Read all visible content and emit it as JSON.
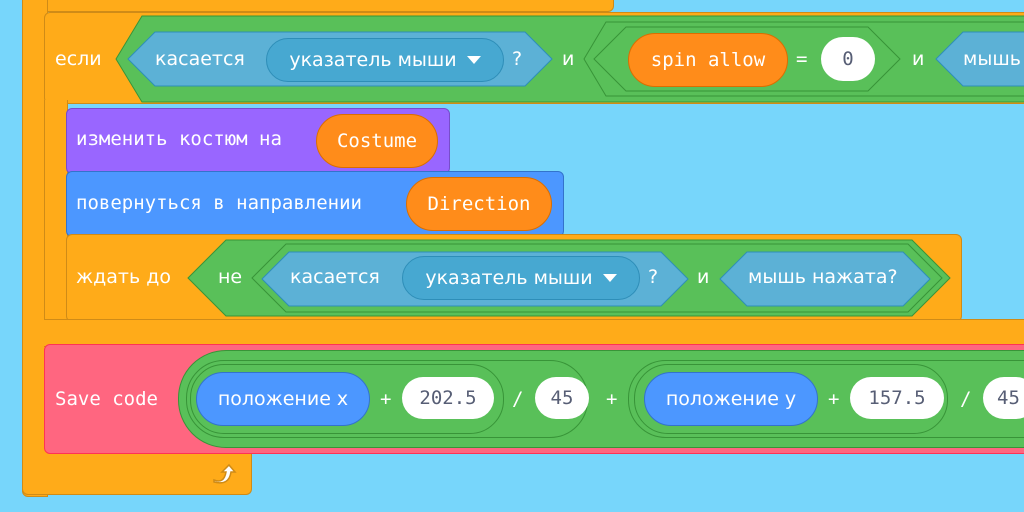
{
  "blocks": {
    "if": {
      "label": "если",
      "touching": {
        "label": "касается",
        "menu": "указатель мыши",
        "suffix": "?"
      },
      "and1": "и",
      "equals": {
        "variable": "spin allow",
        "op": "=",
        "value": "0"
      },
      "and2": "и",
      "mouse": "мышь"
    },
    "switch_costume": {
      "label": "изменить костюм на",
      "value": "Costume"
    },
    "point_direction": {
      "label": "повернуться в направлении",
      "value": "Direction"
    },
    "wait_until": {
      "label": "ждать до",
      "not": "не",
      "touching": {
        "label": "касается",
        "menu": "указатель мыши",
        "suffix": "?"
      },
      "and": "и",
      "mouse_down": "мышь нажата?"
    },
    "save_code": {
      "label": "Save code",
      "x_pos": "положение x",
      "plus1": "+",
      "x_offset": "202.5",
      "div1": "/",
      "x_div": "45",
      "plus2": "+",
      "y_pos": "положение y",
      "plus3": "+",
      "y_offset": "157.5",
      "div2": "/",
      "y_div": "45"
    }
  },
  "icons": {
    "loop_arrow": "loop-arrow-icon",
    "dropdown": "dropdown-triangle-icon"
  },
  "colors": {
    "background": "#77D6FB",
    "control": "#FFAB19",
    "operators": "#59C059",
    "sensing": "#5CB1D6",
    "looks": "#9966FF",
    "motion": "#4C97FF",
    "variables": "#FF8C1A",
    "custom": "#FF6680"
  }
}
